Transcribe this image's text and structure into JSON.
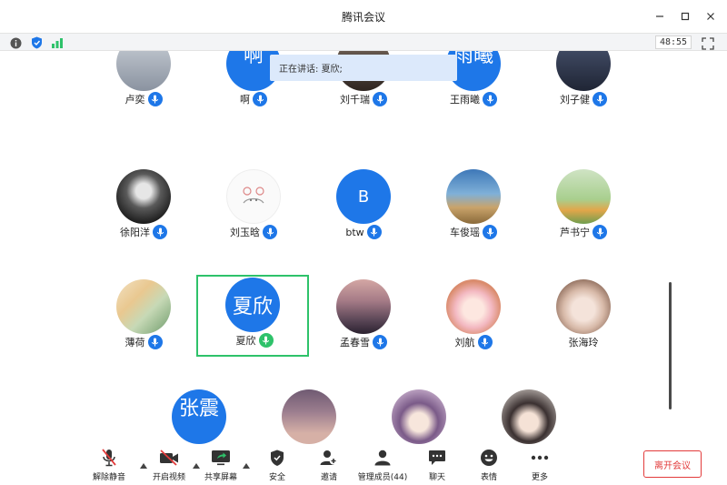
{
  "window": {
    "title": "腾讯会议"
  },
  "infobar": {
    "timer": "48:55"
  },
  "speaking": {
    "label": "正在讲话:",
    "name": "夏欣;"
  },
  "participants": [
    {
      "name": "卢奕"
    },
    {
      "name": "啊",
      "avatar_text": "啊"
    },
    {
      "name": "刘千瑞"
    },
    {
      "name": "王雨曦",
      "avatar_text": "雨曦"
    },
    {
      "name": "刘子健"
    },
    {
      "name": "徐阳洋"
    },
    {
      "name": "刘玉晗"
    },
    {
      "name": "btw",
      "avatar_text": "B"
    },
    {
      "name": "车俊瑶"
    },
    {
      "name": "芦书宁"
    },
    {
      "name": "薄荷"
    },
    {
      "name": "夏欣",
      "avatar_text": "夏欣",
      "speaking": true
    },
    {
      "name": "孟春雪"
    },
    {
      "name": "刘航"
    },
    {
      "name": "张海玲"
    },
    {
      "avatar_text": "张震"
    },
    {},
    {},
    {}
  ],
  "toolbar": {
    "unmute": "解除静音",
    "video": "开启视频",
    "share": "共享屏幕",
    "security": "安全",
    "invite": "邀请",
    "members": "管理成员(44)",
    "chat": "聊天",
    "reactions": "表情",
    "more": "更多",
    "leave": "离开会议"
  },
  "colors": {
    "accent": "#1e77e8",
    "speaking": "#2ec26a",
    "leave": "#e23b3b"
  }
}
